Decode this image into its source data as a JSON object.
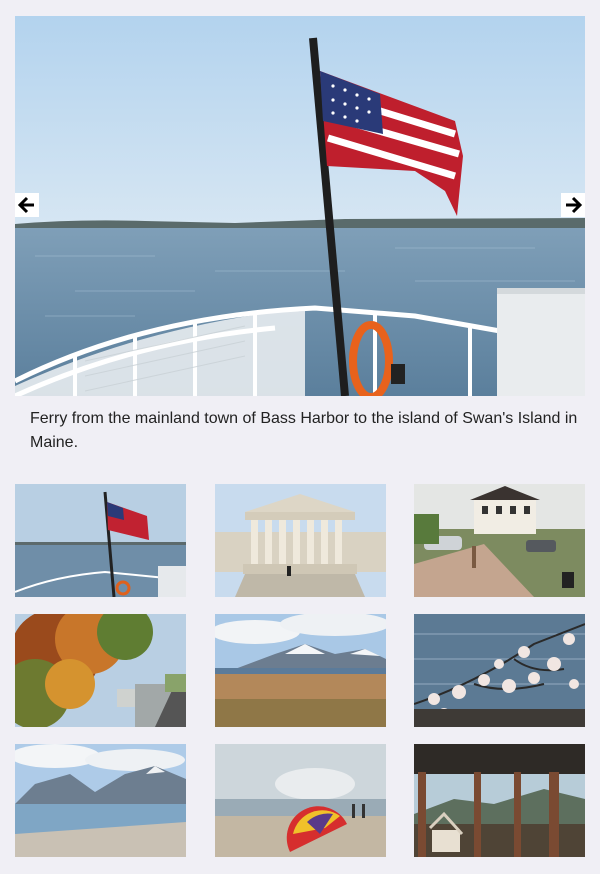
{
  "gallery": {
    "caption": "Ferry from the mainland town of Bass Harbor to the island of Swan's Island in Maine.",
    "prev_icon": "arrow-left-icon",
    "next_icon": "arrow-right-icon",
    "thumbnails": [
      {
        "subject": "ferry-flag"
      },
      {
        "subject": "supreme-court"
      },
      {
        "subject": "street-houses"
      },
      {
        "subject": "autumn-tree"
      },
      {
        "subject": "mountain-plain"
      },
      {
        "subject": "cherry-blossoms"
      },
      {
        "subject": "mountain-lake"
      },
      {
        "subject": "beach-umbrella"
      },
      {
        "subject": "porch-view"
      }
    ]
  }
}
